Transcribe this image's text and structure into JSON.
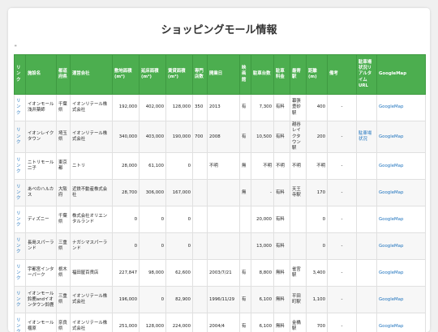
{
  "page": {
    "title": "ショッピングモール情報",
    "mark": "\""
  },
  "table": {
    "headers": [
      "リンク",
      "施設名",
      "都道府県",
      "運営会社",
      "敷地面積(m²)",
      "延床面積(m²)",
      "賃貸面積(m²)",
      "専門店数",
      "開業日",
      "映画館",
      "駐車台数",
      "駐車料金",
      "最寄駅",
      "距離(m)",
      "備考",
      "駐車場状況リアルタイムURL",
      "GoogleMap"
    ],
    "rows": [
      [
        "リンク",
        "イオンモール浅井薬師",
        "千葉県",
        "イオンリテール株式会社",
        "192,000",
        "402,000",
        "128,000",
        "350",
        "2013",
        "有",
        "7,300",
        "有料",
        "幕張豊砂駅",
        "400",
        "-",
        "",
        "GoogleMap"
      ],
      [
        "リンク",
        "イオンレイクタウン",
        "埼玉県",
        "イオンリテール株式会社",
        "340,000",
        "403,000",
        "190,000",
        "700",
        "2008",
        "有",
        "10,500",
        "有料",
        "越谷レイクタウン駅",
        "200",
        "-",
        "駐車場状況",
        "GoogleMap"
      ],
      [
        "リンク",
        "ニトリモール二子",
        "東京都",
        "ニトリ",
        "28,000",
        "61,100",
        "0",
        "",
        "不明",
        "無",
        "不明",
        "不明",
        "不明",
        "不明",
        "-",
        "",
        "GoogleMap"
      ],
      [
        "リンク",
        "あべのハルカス",
        "大阪府",
        "近鉄不動産株式会社",
        "28,700",
        "306,000",
        "167,000",
        "",
        "",
        "無",
        "-",
        "有料",
        "天王寺駅",
        "170",
        "-",
        "",
        "GoogleMap"
      ],
      [
        "リンク",
        "ディズニー",
        "千葉県",
        "株式会社オリエンタルランド",
        "0",
        "0",
        "0",
        "",
        "",
        "",
        "20,000",
        "有料",
        "",
        "0",
        "-",
        "",
        "GoogleMap"
      ],
      [
        "リンク",
        "長島スパーランド",
        "三重県",
        "ナガシマスパーランド",
        "0",
        "0",
        "0",
        "",
        "",
        "",
        "13,000",
        "有料",
        "",
        "0",
        "-",
        "",
        "GoogleMap"
      ],
      [
        "リンク",
        "宇都宮インターパーク",
        "栃木県",
        "福田屋百貨店",
        "227,847",
        "98,000",
        "62,600",
        "",
        "2003/7/21",
        "有",
        "8,800",
        "無料",
        "雀宮駅",
        "3,400",
        "-",
        "",
        "GoogleMap"
      ],
      [
        "リンク",
        "イオンモール鈴鹿andイオンタウン鈴鹿",
        "三重県",
        "イオンリテール株式会社",
        "196,000",
        "0",
        "82,900",
        "",
        "1996/11/29",
        "有",
        "6,100",
        "無料",
        "平田町駅",
        "1,100",
        "-",
        "",
        "GoogleMap"
      ],
      [
        "リンク",
        "イオンモール橿原",
        "奈良県",
        "イオンリテール株式会社",
        "251,000",
        "128,000",
        "224,000",
        "",
        "2004/4",
        "有",
        "6,100",
        "無料",
        "金橋駅",
        "700",
        "-",
        "",
        "GoogleMap"
      ]
    ]
  },
  "colors": {
    "header_bg": "#4cae4f",
    "link": "#1e73be"
  }
}
